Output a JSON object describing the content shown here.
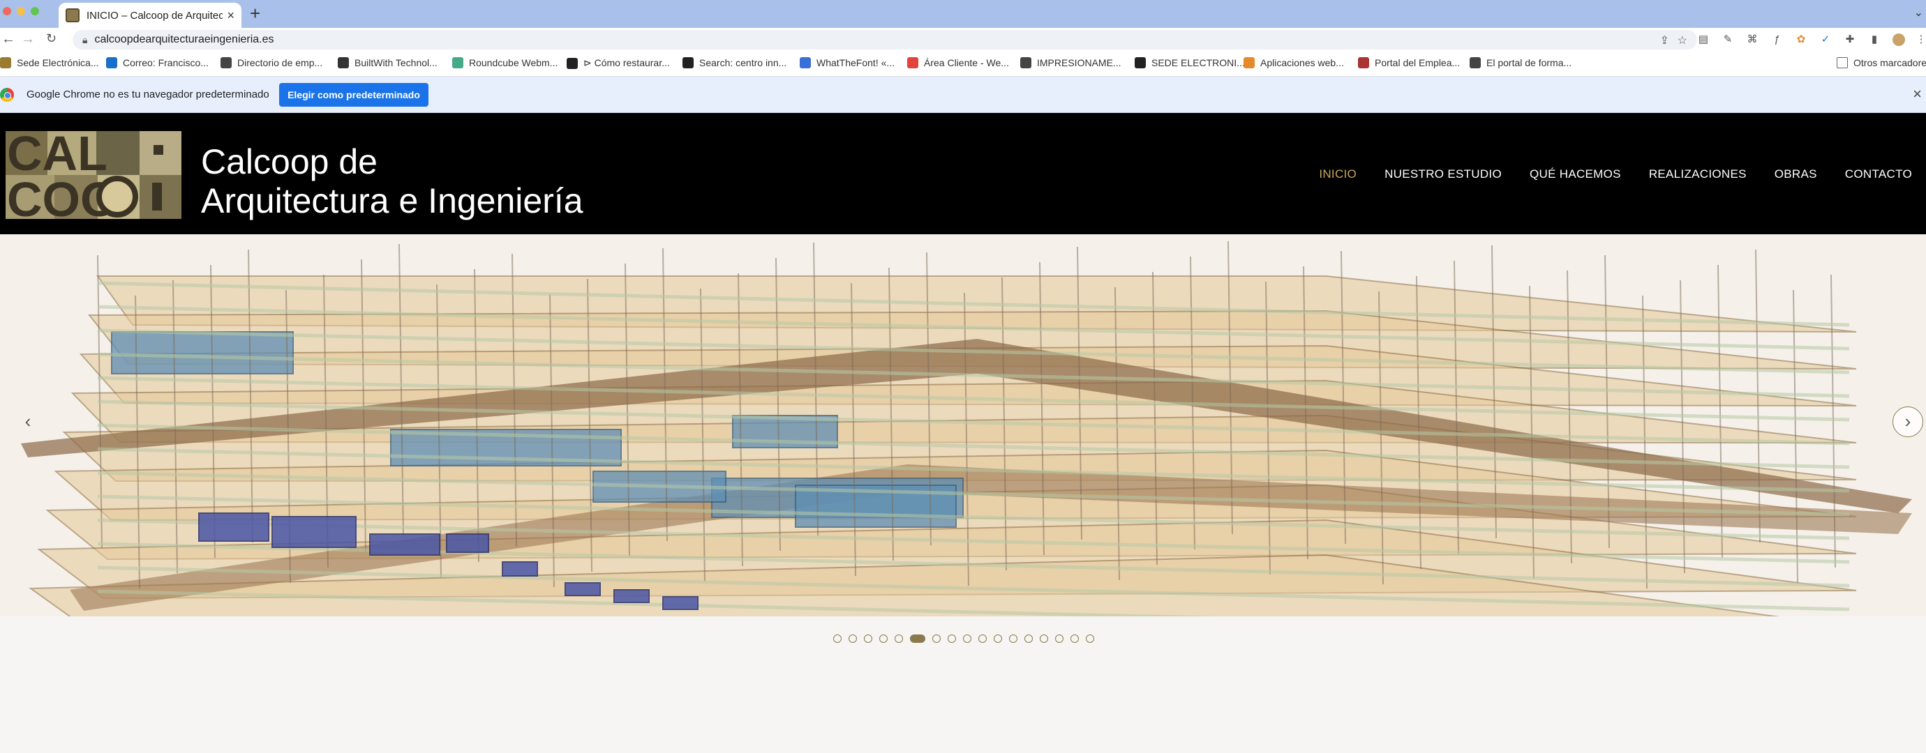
{
  "browser": {
    "tab_title": "INICIO – Calcoop de Arquitectura e Ingeniería",
    "new_tab": "+",
    "url": "calcoopdearquitecturaeingenieria.es",
    "close": "×"
  },
  "bookmarks": [
    {
      "label": "Sede Electrónica...",
      "icon": "sede-icon",
      "color": "#9a7b2f"
    },
    {
      "label": "Correo: Francisco...",
      "icon": "outlook-icon",
      "color": "#1a6fc8"
    },
    {
      "label": "Directorio de emp...",
      "icon": "globe-icon",
      "color": "#444"
    },
    {
      "label": "BuiltWith Technol...",
      "icon": "builtwith-icon",
      "color": "#333"
    },
    {
      "label": "Roundcube Webm...",
      "icon": "roundcube-icon",
      "color": "#4a8"
    },
    {
      "label": "⊳ Cómo restaurar...",
      "icon": "site-icon",
      "color": "#222"
    },
    {
      "label": "Search: centro inn...",
      "icon": "s-icon",
      "color": "#222"
    },
    {
      "label": "WhatTheFont! «...",
      "icon": "wtf-icon",
      "color": "#3a6fd8"
    },
    {
      "label": "Área Cliente - We...",
      "icon": "w-icon",
      "color": "#e3433a"
    },
    {
      "label": "IMPRESIONAME...",
      "icon": "globe-icon",
      "color": "#444"
    },
    {
      "label": "SEDE ELECTRONI...",
      "icon": "sede-icon",
      "color": "#222"
    },
    {
      "label": "Aplicaciones web...",
      "icon": "apps-icon",
      "color": "#e58a2a"
    },
    {
      "label": "Portal del Emplea...",
      "icon": "portal-icon",
      "color": "#a33"
    },
    {
      "label": "El portal de forma...",
      "icon": "globe-icon",
      "color": "#444"
    }
  ],
  "bookmarks_other": "Otros marcadores",
  "infobar": {
    "message": "Google Chrome no es tu navegador predeterminado",
    "cta": "Elegir como predeterminado",
    "close": "×"
  },
  "site": {
    "title_line1": "Calcoop de",
    "title_line2": "Arquitectura e Ingeniería",
    "nav": [
      {
        "label": "INICIO",
        "active": true
      },
      {
        "label": "NUESTRO ESTUDIO",
        "active": false
      },
      {
        "label": "QUÉ HACEMOS",
        "active": false
      },
      {
        "label": "REALIZACIONES",
        "active": false
      },
      {
        "label": "OBRAS",
        "active": false
      },
      {
        "label": "CONTACTO",
        "active": false
      }
    ],
    "slider": {
      "prev": "‹",
      "next": "›",
      "total_slides": 17,
      "active_slide": 6
    },
    "accent_color": "#c9a85a"
  }
}
